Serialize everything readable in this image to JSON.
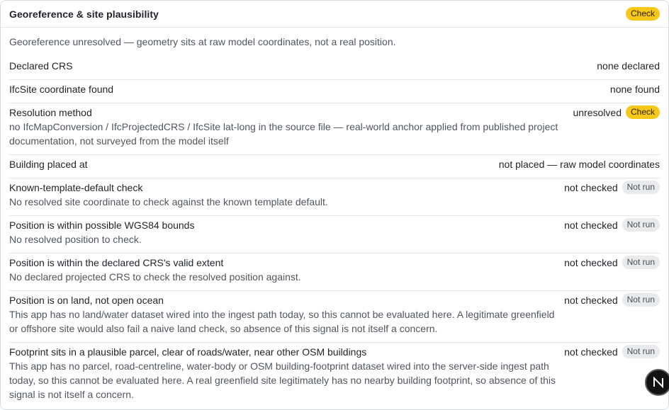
{
  "panel": {
    "title": "Georeference & site plausibility",
    "status_badge": "Check",
    "summary": "Georeference unresolved — geometry sits at raw model coordinates, not a real position."
  },
  "rows": [
    {
      "label": "Declared CRS",
      "desc": "",
      "value": "none declared",
      "badge": ""
    },
    {
      "label": "IfcSite coordinate found",
      "desc": "",
      "value": "none found",
      "badge": ""
    },
    {
      "label": "Resolution method",
      "desc": "no IfcMapConversion / IfcProjectedCRS / IfcSite lat-long in the source file — real-world anchor applied from published project documentation, not surveyed from the model itself",
      "value": "unresolved",
      "badge": "Check"
    },
    {
      "label": "Building placed at",
      "desc": "",
      "value": "not placed — raw model coordinates",
      "badge": ""
    },
    {
      "label": "Known-template-default check",
      "desc": "No resolved site coordinate to check against the known template default.",
      "value": "not checked",
      "badge": "Not run"
    },
    {
      "label": "Position is within possible WGS84 bounds",
      "desc": "No resolved position to check.",
      "value": "not checked",
      "badge": "Not run"
    },
    {
      "label": "Position is within the declared CRS's valid extent",
      "desc": "No declared projected CRS to check the resolved position against.",
      "value": "not checked",
      "badge": "Not run"
    },
    {
      "label": "Position is on land, not open ocean",
      "desc": "This app has no land/water dataset wired into the ingest path today, so this cannot be evaluated here. A legitimate greenfield or offshore site would also fail a naive land check, so absence of this signal is not itself a concern.",
      "value": "not checked",
      "badge": "Not run"
    },
    {
      "label": "Footprint sits in a plausible parcel, clear of roads/water, near other OSM buildings",
      "desc": "This app has no parcel, road-centreline, water-body or OSM building-footprint dataset wired into the server-side ingest path today, so this cannot be evaluated here. A real greenfield site legitimately has no nearby building footprint, so absence of this signal is not itself a concern.",
      "value": "not checked",
      "badge": "Not run"
    }
  ],
  "floating_button": {
    "icon": "next-logo-icon",
    "letter": "N"
  },
  "colors": {
    "check_badge": "#f7c81a",
    "notrun_badge": "#e9eaec",
    "border": "#e3e5e8"
  }
}
